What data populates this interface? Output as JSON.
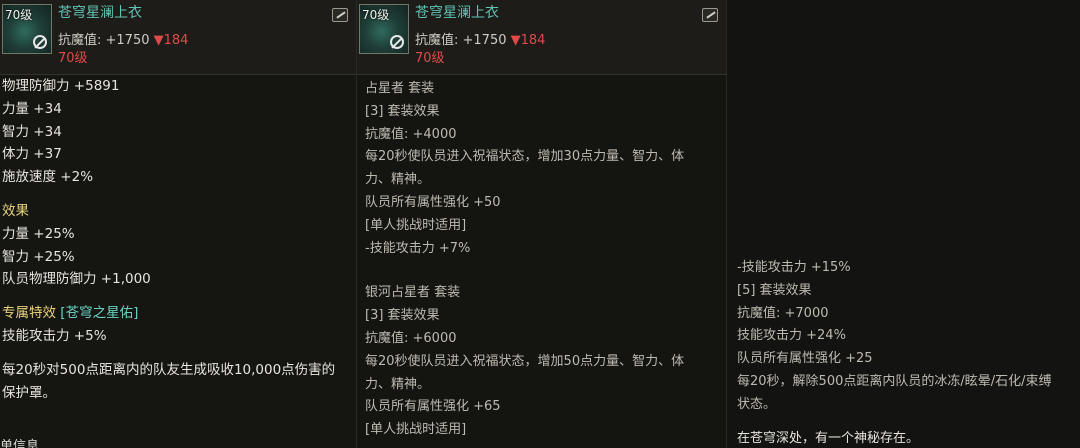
{
  "panels": [
    {
      "item": {
        "level_badge": "70级",
        "name": "苍穹星澜上衣",
        "stat": "抗魔值: +1750",
        "stat_down": "▼184",
        "level": "70级"
      },
      "lines": [
        "物理防御力 +5891",
        "力量 +34",
        "智力 +34",
        "体力 +37",
        "施放速度 +2%",
        "效果",
        "力量 +25%",
        "智力 +25%",
        "队员物理防御力 +1,000",
        "专属特效",
        "[苍穹之星佑]",
        "技能攻击力 +5%",
        "每20秒对500点距离内的队友生成吸收10,000点伤害的",
        "保护罩。",
        "单信息"
      ]
    },
    {
      "item": {
        "level_badge": "70级",
        "name": "苍穹星澜上衣",
        "stat": "抗魔值: +1750",
        "stat_down": "▼184",
        "level": "70级"
      },
      "lines": [
        "占星者  套装",
        "[3] 套装效果",
        "抗魔值: +4000",
        "每20秒使队员进入祝福状态，增加30点力量、智力、体",
        "力、精神。",
        "队员所有属性强化 +50",
        "[单人挑战时适用]",
        "-技能攻击力 +7%",
        "银河占星者  套装",
        "[3] 套装效果",
        "抗魔值: +6000",
        "每20秒使队员进入祝福状态，增加50点力量、智力、体",
        "力、精神。",
        "队员所有属性强化 +65",
        "[单人挑战时适用]"
      ]
    },
    {
      "lines": [
        "-技能攻击力 +15%",
        "[5] 套装效果",
        "抗魔值: +7000",
        "技能攻击力 +24%",
        "队员所有属性强化 +25",
        "每20秒，解除500点距离内队员的冰冻/眩晕/石化/束缚",
        "状态。",
        "在苍穹深处，有一个神秘存在。"
      ]
    }
  ]
}
